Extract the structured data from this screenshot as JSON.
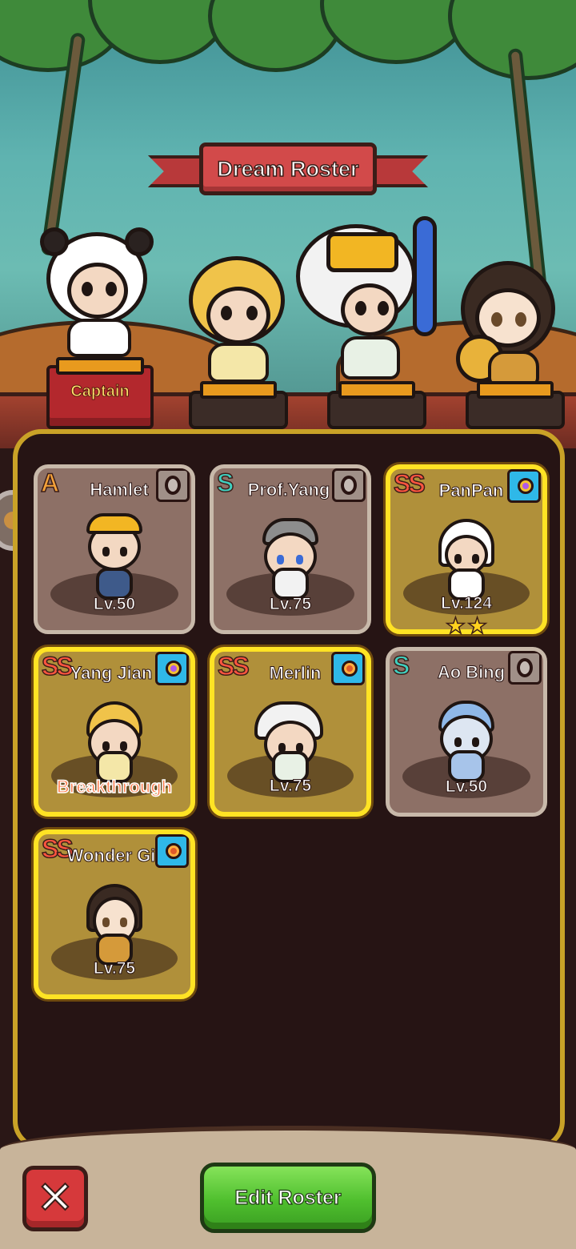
{
  "header": {
    "title": "Dream Roster"
  },
  "stage": {
    "captain_label": "Captain"
  },
  "roster": [
    {
      "name": "Hamlet",
      "tier": "A",
      "level_text": "Lv.50",
      "selected": false,
      "badge": "grey-ring",
      "icon": "hamlet-portrait-icon"
    },
    {
      "name": "Prof.Yang",
      "tier": "S",
      "level_text": "Lv.75",
      "selected": false,
      "badge": "grey-ring",
      "icon": "prof-yang-portrait-icon"
    },
    {
      "name": "PanPan",
      "tier": "SS",
      "level_text": "Lv.124",
      "selected": true,
      "badge": "blue-purple-gem",
      "icon": "panpan-portrait-icon",
      "stars": 2
    },
    {
      "name": "Yang Jian",
      "tier": "SS",
      "level_text": "Breakthrough",
      "selected": true,
      "badge": "blue-purple-gem",
      "icon": "yang-jian-portrait-icon"
    },
    {
      "name": "Merlin",
      "tier": "SS",
      "level_text": "Lv.75",
      "selected": true,
      "badge": "blue-orange-gem",
      "icon": "merlin-portrait-icon"
    },
    {
      "name": "Ao Bing",
      "tier": "S",
      "level_text": "Lv.50",
      "selected": false,
      "badge": "grey-ring",
      "icon": "ao-bing-portrait-icon"
    },
    {
      "name": "Wonder Gi",
      "tier": "SS",
      "level_text": "Lv.75",
      "selected": true,
      "badge": "blue-orange-gem",
      "icon": "wonder-girl-portrait-icon"
    }
  ],
  "buttons": {
    "close_icon": "✕",
    "edit_label": "Edit Roster"
  },
  "colors": {
    "gold_border": "#ffe324",
    "panel_border": "#c9a227",
    "close_red": "#d6393b",
    "edit_green": "#4fbf2e"
  }
}
